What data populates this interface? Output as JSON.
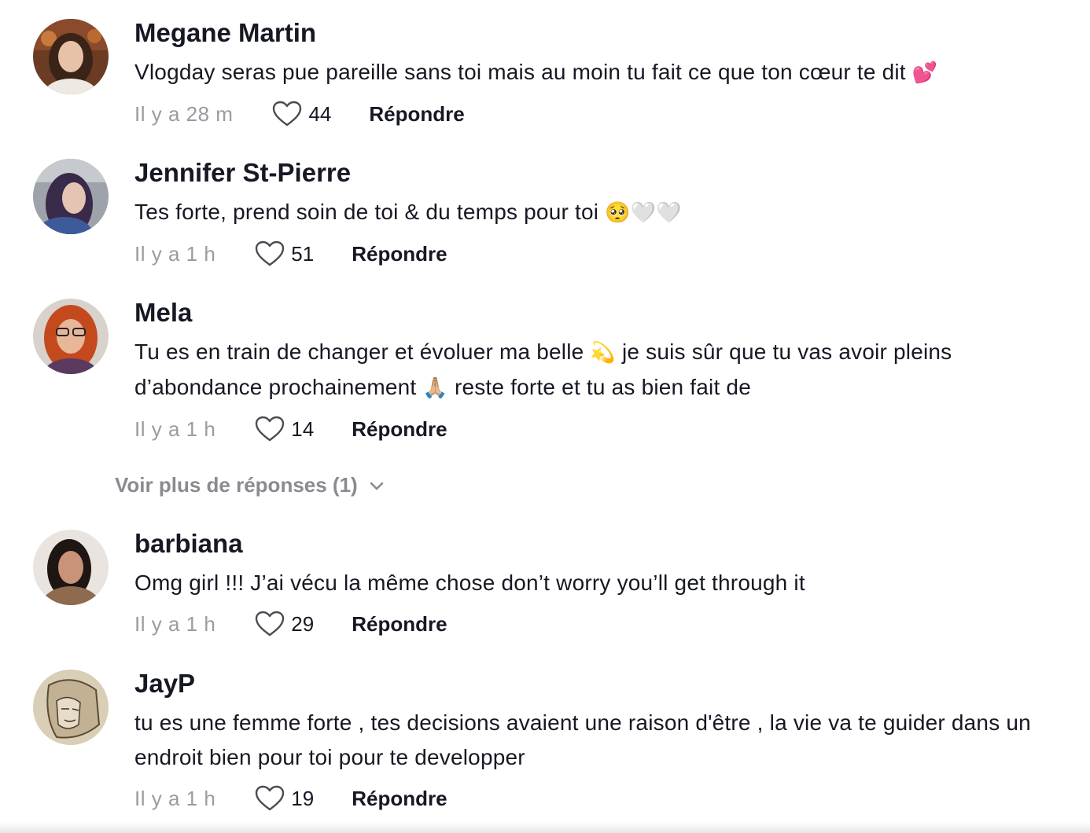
{
  "comments": [
    {
      "username": "Megane Martin",
      "text": "Vlogday seras pue pareille sans toi mais au moin tu fait ce que ton cœur te dit",
      "emoji": "💕",
      "time": "Il y a 28 m",
      "likes": "44",
      "reply_label": "Répondre"
    },
    {
      "username": "Jennifer St-Pierre",
      "text": "Tes forte, prend soin de toi & du temps pour toi",
      "emoji": "🥺🤍🤍",
      "time": "Il y a 1 h",
      "likes": "51",
      "reply_label": "Répondre"
    },
    {
      "username": "Mela",
      "text_part1": "Tu es en train de changer et évoluer ma belle",
      "emoji1": "💫",
      "text_part2": "je suis sûr que tu vas avoir pleins d’abondance prochainement",
      "emoji2": "🙏🏼",
      "text_part3": "reste forte et tu as bien fait de",
      "time": "Il y a 1 h",
      "likes": "14",
      "reply_label": "Répondre"
    },
    {
      "username": "barbiana",
      "text": "Omg girl !!! J’ai vécu la même chose don’t worry you’ll get through it",
      "time": "Il y a 1 h",
      "likes": "29",
      "reply_label": "Répondre"
    },
    {
      "username": "JayP",
      "text": "tu es une femme forte , tes decisions avaient une raison d'être , la vie va te guider dans un endroit bien pour toi pour te developper",
      "time": "Il y a 1 h",
      "likes": "19",
      "reply_label": "Répondre"
    }
  ],
  "view_more_replies": "Voir plus de réponses (1)",
  "icons": {
    "like": "heart-outline-icon",
    "expand": "chevron-down-icon"
  },
  "colors": {
    "text": "#161823",
    "muted": "#9a9ba1",
    "view_more": "#8a8b91"
  }
}
